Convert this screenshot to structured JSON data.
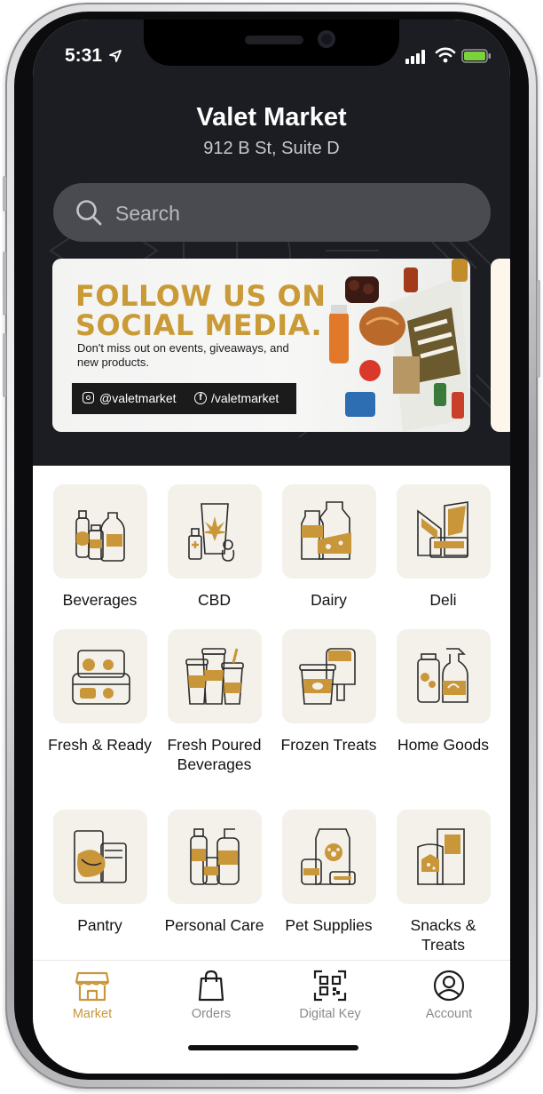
{
  "status_bar": {
    "time": "5:31"
  },
  "header": {
    "title": "Valet Market",
    "address": "912 B St, Suite D"
  },
  "search": {
    "placeholder": "Search"
  },
  "promo_banner": {
    "headline_line1": "FOLLOW US ON",
    "headline_line2": "SOCIAL MEDIA.",
    "subtext": "Don't miss out on events, giveaways, and new products.",
    "instagram": "@valetmarket",
    "facebook": "/valetmarket"
  },
  "categories": [
    {
      "label": "Beverages",
      "icon": "beverages-icon"
    },
    {
      "label": "CBD",
      "icon": "cbd-icon"
    },
    {
      "label": "Dairy",
      "icon": "dairy-icon"
    },
    {
      "label": "Deli",
      "icon": "deli-icon"
    },
    {
      "label": "Fresh & Ready",
      "icon": "fresh-ready-icon"
    },
    {
      "label": "Fresh Poured Beverages",
      "icon": "fresh-poured-icon"
    },
    {
      "label": "Frozen Treats",
      "icon": "frozen-treats-icon"
    },
    {
      "label": "Home Goods",
      "icon": "home-goods-icon"
    },
    {
      "label": "Pantry",
      "icon": "pantry-icon"
    },
    {
      "label": "Personal Care",
      "icon": "personal-care-icon"
    },
    {
      "label": "Pet Supplies",
      "icon": "pet-supplies-icon"
    },
    {
      "label": "Snacks & Treats",
      "icon": "snacks-treats-icon"
    }
  ],
  "tab_bar": {
    "items": [
      {
        "label": "Market",
        "icon": "storefront-icon",
        "active": true
      },
      {
        "label": "Orders",
        "icon": "shopping-bag-icon",
        "active": false
      },
      {
        "label": "Digital Key",
        "icon": "qr-code-icon",
        "active": false
      },
      {
        "label": "Account",
        "icon": "account-icon",
        "active": false
      }
    ]
  },
  "colors": {
    "accent": "#c9963a",
    "header_bg": "#1b1d22",
    "tile_bg": "#f3f1ea",
    "banner_gold": "#c99a35"
  }
}
